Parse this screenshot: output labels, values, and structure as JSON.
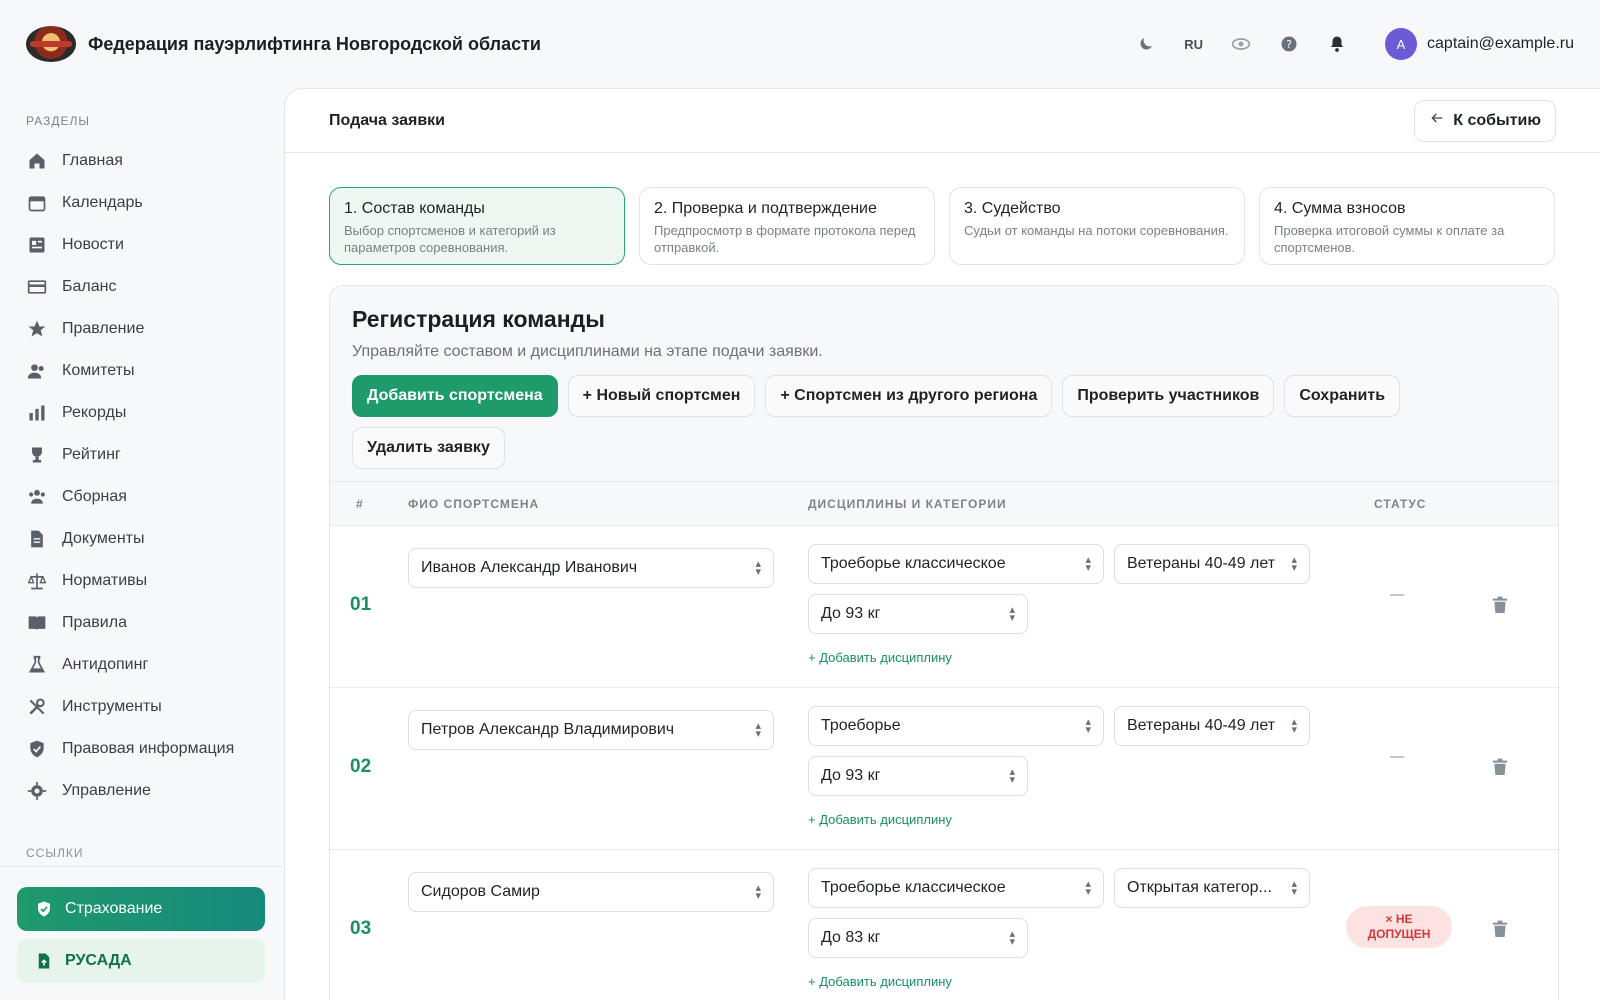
{
  "header": {
    "org_title": "Федерация пауэрлифтинга Новгородской области",
    "lang": "RU",
    "avatar_letter": "A",
    "user_email": "captain@example.ru"
  },
  "sidebar": {
    "section_label": "РАЗДЕЛЫ",
    "items": [
      {
        "label": "Главная",
        "icon": "home-icon"
      },
      {
        "label": "Календарь",
        "icon": "calendar-icon"
      },
      {
        "label": "Новости",
        "icon": "news-icon"
      },
      {
        "label": "Баланс",
        "icon": "wallet-icon"
      },
      {
        "label": "Правление",
        "icon": "star-icon"
      },
      {
        "label": "Комитеты",
        "icon": "users-icon"
      },
      {
        "label": "Рекорды",
        "icon": "bar-chart-icon"
      },
      {
        "label": "Рейтинг",
        "icon": "trophy-icon"
      },
      {
        "label": "Сборная",
        "icon": "team-icon"
      },
      {
        "label": "Документы",
        "icon": "document-icon"
      },
      {
        "label": "Нормативы",
        "icon": "scales-icon"
      },
      {
        "label": "Правила",
        "icon": "book-icon"
      },
      {
        "label": "Антидопинг",
        "icon": "flask-icon"
      },
      {
        "label": "Инструменты",
        "icon": "tools-icon"
      },
      {
        "label": "Правовая информация",
        "icon": "shield-icon"
      },
      {
        "label": "Управление",
        "icon": "gear-icon"
      }
    ],
    "links_label": "ССЫЛКИ",
    "insurance_label": "Страхование",
    "rusada_label": "РУСАДА"
  },
  "main": {
    "title": "Подача заявки",
    "back_label": "К событию",
    "steps": [
      {
        "title": "1. Состав команды",
        "desc": "Выбор спортсменов и категорий из параметров соревнования."
      },
      {
        "title": "2. Проверка и подтверждение",
        "desc": "Предпросмотр в формате протокола перед отправкой."
      },
      {
        "title": "3. Судейство",
        "desc": "Судьи от команды на потоки соревнования."
      },
      {
        "title": "4. Сумма взносов",
        "desc": "Проверка итоговой суммы к оплате за спортсменов."
      }
    ],
    "card": {
      "title": "Регистрация команды",
      "subtitle": "Управляйте составом и дисциплинами на этапе подачи заявки.",
      "buttons": {
        "add_athlete": "Добавить спортсмена",
        "new_athlete": "+ Новый спортсмен",
        "other_region": "+ Спортсмен из другого региона",
        "check": "Проверить участников",
        "save": "Сохранить",
        "delete": "Удалить заявку"
      },
      "columns": {
        "num": "#",
        "name": "ФИО СПОРТСМЕНА",
        "disciplines": "ДИСЦИПЛИНЫ И КАТЕГОРИИ",
        "status": "СТАТУС"
      },
      "add_discipline": "+ Добавить дисциплину",
      "rows": [
        {
          "num": "01",
          "name": "Иванов Александр Иванович",
          "discipline": "Троеборье классическое",
          "category": "Ветераны 40-49 лет",
          "weight": "До 93 кг",
          "status": "—"
        },
        {
          "num": "02",
          "name": "Петров Александр Владимирович",
          "discipline": "Троеборье",
          "category": "Ветераны 40-49 лет",
          "weight": "До 93 кг",
          "status": "—"
        },
        {
          "num": "03",
          "name": "Сидоров Самир",
          "discipline": "Троеборье классическое",
          "category": "Открытая категор...",
          "weight": "До 83 кг",
          "status_line1": "× НЕ",
          "status_line2": "ДОПУЩЕН"
        }
      ]
    }
  }
}
